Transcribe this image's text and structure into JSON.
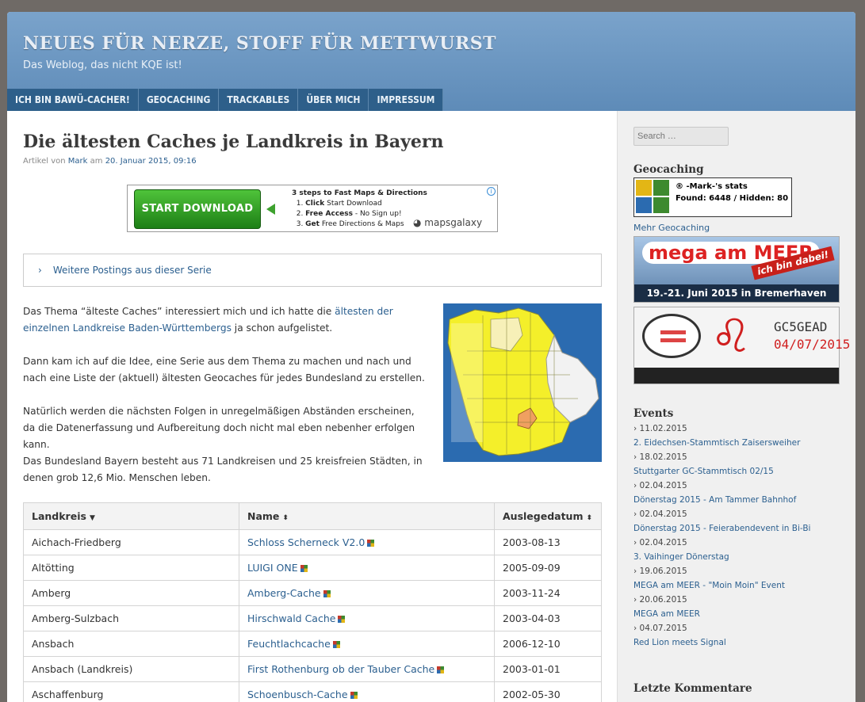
{
  "site": {
    "title": "NEUES FÜR NERZE, STOFF FÜR METTWURST",
    "description": "Das Weblog, das nicht KQE ist!"
  },
  "nav": {
    "items": [
      "ICH BIN BAWÜ-CACHER!",
      "GEOCACHING",
      "TRACKABLES",
      "ÜBER MICH",
      "IMPRESSUM"
    ]
  },
  "post": {
    "title": "Die ältesten Caches je Landkreis in Bayern",
    "meta_prefix": "Artikel von",
    "author": "Mark",
    "meta_mid": "am",
    "date": "20. Januar 2015, 09:16",
    "series_label": "Weitere Postings aus dieser Serie",
    "p1_a": "Das Thema “älteste Caches” interessiert mich und ich hatte die ",
    "p1_link": "ältesten der einzelnen Landkreise Baden-Württembergs",
    "p1_b": " ja schon aufgelistet.",
    "p2": "Dann kam ich auf die Idee, eine Serie aus dem Thema zu machen und nach und nach eine Liste der (aktuell) ältesten Geocaches für jedes Bundesland zu erstellen.",
    "p3": "Natürlich werden die nächsten Folgen in unregelmäßigen Abständen erscheinen, da die Datenerfassung und Aufbereitung doch nicht mal eben nebenher erfolgen kann.",
    "p4": "Das Bundesland Bayern besteht aus 71 Landkreisen und 25 kreisfreien Städten, in denen grob 12,6 Mio. Menschen leben."
  },
  "ad": {
    "button": "START DOWNLOAD",
    "heading": "3 steps to Fast Maps & Directions",
    "step1_b": "Click",
    "step1": " Start Download",
    "step2_b": "Free Access",
    "step2": " - No Sign up!",
    "step3_b": "Get",
    "step3": " Free Directions & Maps",
    "logo": "mapsgalaxy"
  },
  "table": {
    "headers": [
      "Landkreis",
      "Name",
      "Auslegedatum"
    ],
    "rows": [
      [
        "Aichach-Friedberg",
        "Schloss Scherneck V2.0",
        "2003-08-13"
      ],
      [
        "Altötting",
        "LUIGI ONE",
        "2005-09-09"
      ],
      [
        "Amberg",
        "Amberg-Cache",
        "2003-11-24"
      ],
      [
        "Amberg-Sulzbach",
        "Hirschwald Cache",
        "2003-04-03"
      ],
      [
        "Ansbach",
        "Feuchtlachcache",
        "2006-12-10"
      ],
      [
        "Ansbach (Landkreis)",
        "First Rothenburg ob der Tauber Cache",
        "2003-01-01"
      ],
      [
        "Aschaffenburg",
        "Schoenbusch-Cache",
        "2002-05-30"
      ]
    ]
  },
  "sidebar": {
    "search_placeholder": "Search …",
    "geocaching_title": "Geocaching",
    "stats_name": "® -Mark-'s stats",
    "stats_found": "Found: 6448 / Hidden: 80",
    "more_link": "Mehr Geocaching",
    "banner1_mega": "mega am MEER",
    "banner1_tag": "ich bin dabei!",
    "banner1_date": "19.-21. Juni 2015 in Bremerhaven",
    "banner2_code": "GC5GEAD",
    "banner2_date": "04/07/2015",
    "events_title": "Events",
    "events": [
      {
        "date": "› 11.02.2015",
        "title": "2. Eidechsen-Stammtisch Zaisersweiher"
      },
      {
        "date": "› 18.02.2015",
        "title": "Stuttgarter GC-Stammtisch 02/15"
      },
      {
        "date": "› 02.04.2015",
        "title": "Dönerstag 2015 - Am Tammer Bahnhof"
      },
      {
        "date": "› 02.04.2015",
        "title": "Dönerstag 2015 - Feierabendevent in Bi-Bi"
      },
      {
        "date": "› 02.04.2015",
        "title": "3. Vaihinger Dönerstag"
      },
      {
        "date": "› 19.06.2015",
        "title": "MEGA am MEER - \"Moin Moin\" Event"
      },
      {
        "date": "› 20.06.2015",
        "title": "MEGA am MEER"
      },
      {
        "date": "› 04.07.2015",
        "title": "Red Lion meets Signal"
      }
    ],
    "comments_title": "Letzte Kommentare"
  }
}
